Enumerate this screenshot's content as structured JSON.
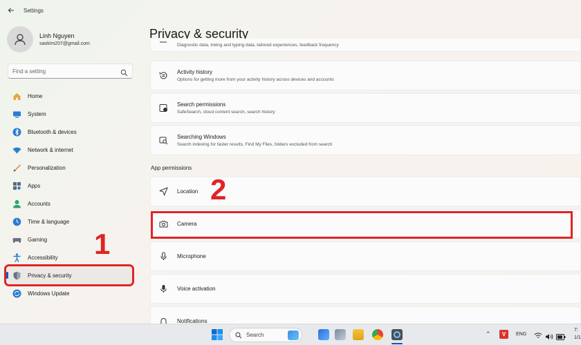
{
  "window": {
    "title": "Settings"
  },
  "profile": {
    "name": "Linh Nguyen",
    "email": "saokim207@gmail.com"
  },
  "search": {
    "placeholder": "Find a setting"
  },
  "nav": {
    "items": [
      {
        "label": "Home",
        "icon": "home-icon",
        "color": "#e8a33d"
      },
      {
        "label": "System",
        "icon": "system-icon",
        "color": "#2b7cd3"
      },
      {
        "label": "Bluetooth & devices",
        "icon": "bluetooth-icon",
        "color": "#2b7cd3"
      },
      {
        "label": "Network & internet",
        "icon": "network-icon",
        "color": "#2b7cd3"
      },
      {
        "label": "Personalization",
        "icon": "personalization-icon",
        "color": "#d9822b"
      },
      {
        "label": "Apps",
        "icon": "apps-icon",
        "color": "#5b6b7b"
      },
      {
        "label": "Accounts",
        "icon": "accounts-icon",
        "color": "#2aa36b"
      },
      {
        "label": "Time & language",
        "icon": "time-language-icon",
        "color": "#2b7cd3"
      },
      {
        "label": "Gaming",
        "icon": "gaming-icon",
        "color": "#6b7280"
      },
      {
        "label": "Accessibility",
        "icon": "accessibility-icon",
        "color": "#2b7cd3"
      },
      {
        "label": "Privacy & security",
        "icon": "shield-icon",
        "color": "#6b7280"
      },
      {
        "label": "Windows Update",
        "icon": "windows-update-icon",
        "color": "#2b7cd3"
      }
    ],
    "active_index": 10
  },
  "content": {
    "page_title": "Privacy & security",
    "partial_card_desc": "Diagnostic data, inking and typing data, tailored experiences, feedback frequency",
    "cards": [
      {
        "title": "Activity history",
        "desc": "Options for getting more from your activity history across devices and accounts"
      },
      {
        "title": "Search permissions",
        "desc": "SafeSearch, cloud content search, search history"
      },
      {
        "title": "Searching Windows",
        "desc": "Search indexing for faster results, Find My Files, folders excluded from search"
      }
    ],
    "section_label": "App permissions",
    "permissions": [
      {
        "title": "Location"
      },
      {
        "title": "Camera"
      },
      {
        "title": "Microphone"
      },
      {
        "title": "Voice activation"
      },
      {
        "title": "Notifications"
      }
    ]
  },
  "annotations": {
    "step1": "1",
    "step2": "2",
    "color": "#e02424"
  },
  "taskbar": {
    "search_label": "Search",
    "language": "ENG",
    "clock_line1": "7:",
    "clock_line2": "1/1"
  }
}
